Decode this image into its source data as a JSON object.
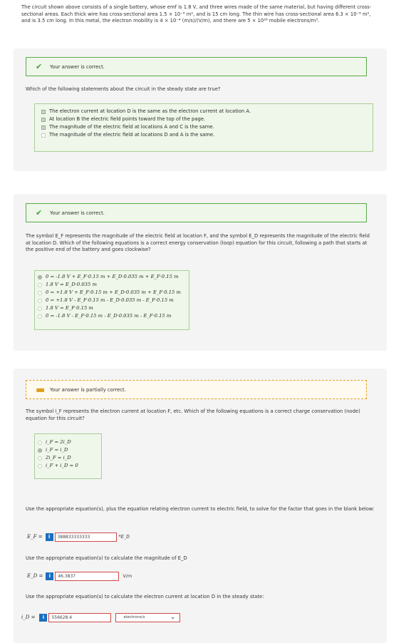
{
  "intro": "The circuit shown above consists of a single battery, whose emf is 1.8 V, and three wires made of the same material, but having different cross-sectional areas. Each thick wire has cross-sectional area 1.5 × 10⁻⁶ m², and is 15 cm long. The thin wire has cross-sectional area 6.3 × 10⁻⁸ m², and is 3.5 cm long. In this metal, the electron mobility is 4 × 10⁻⁴ (m/s)/(V/m), and there are 5 × 10²⁸ mobile electrons/m³.",
  "q1": {
    "feedback": "Your answer is correct.",
    "question": "Which of the following statements about the circuit in the steady state are true?",
    "options": [
      {
        "label": "The electron current at location D is the same as the electron current at location A.",
        "checked": true
      },
      {
        "label": "At location B the electric field points toward the top of the page.",
        "checked": true
      },
      {
        "label": "The magnitude of the electric field at locations A and C is the same.",
        "checked": true
      },
      {
        "label": "The magnitude of the electric field at locations D and A is the same.",
        "checked": false
      }
    ]
  },
  "q2": {
    "feedback": "Your answer is correct.",
    "question": "The symbol E_F represents the magnitude of the electric field at location F, and the symbol E_D represents the magnitude of the electric field at location D. Which of the following equations is a correct energy conservation (loop) equation for this circuit, following a path that starts at the positive end of the battery and goes clockwise?",
    "options": [
      {
        "label": "0 = -1.8 V + E_F·0.15 m + E_D·0.035 m + E_F·0.15 m",
        "selected": true
      },
      {
        "label": "1.8 V = E_D·0.035 m",
        "selected": false
      },
      {
        "label": "0 = +1.8 V + E_F·0.15 m + E_D·0.035 m + E_F·0.15 m",
        "selected": false
      },
      {
        "label": "0 = +1.8 V - E_F·0.15 m - E_D·0.035 m - E_F·0.15 m",
        "selected": false
      },
      {
        "label": "1.8 V = E_F·0.15 m",
        "selected": false
      },
      {
        "label": "0 = -1.8 V - E_F·0.15 m - E_D·0.035 m - E_F·0.15 m",
        "selected": false
      }
    ]
  },
  "q3": {
    "feedback": "Your answer is partially correct.",
    "question": "The symbol i_F represents the electron current at location F, etc. Which of the following equations is a correct charge conservation (node) equation for this circuit?",
    "options": [
      {
        "label": "i_F = 2i_D",
        "selected": false
      },
      {
        "label": "i_F = i_D",
        "selected": true
      },
      {
        "label": "2i_F = i_D",
        "selected": false
      },
      {
        "label": "i_F + i_D = 0",
        "selected": false
      }
    ],
    "prompt_factor": "Use the appropriate equation(s), plus the equation relating electron current to electric field, to solve for the factor that goes in the blank below:",
    "ef_var": "E_F =",
    "ef_value": "388833333333",
    "ef_suffix": "*E_D",
    "prompt_ed": "Use the appropriate equation(s) to calculate the magnitude of E_D",
    "ed_var": "E_D =",
    "ed_value": "46.3837",
    "ed_unit": "V/m",
    "prompt_id": "Use the appropriate equation(s) to calculate the electron current at location D in the steady state:",
    "id_var": "i_D =",
    "id_value": "556628.4",
    "id_unit": "electrons/s"
  },
  "info_glyph": "i",
  "colors": {
    "correct": "#48a23a",
    "partial": "#e0a020",
    "info": "#1a6fc0",
    "error_border": "#d04a4a"
  }
}
